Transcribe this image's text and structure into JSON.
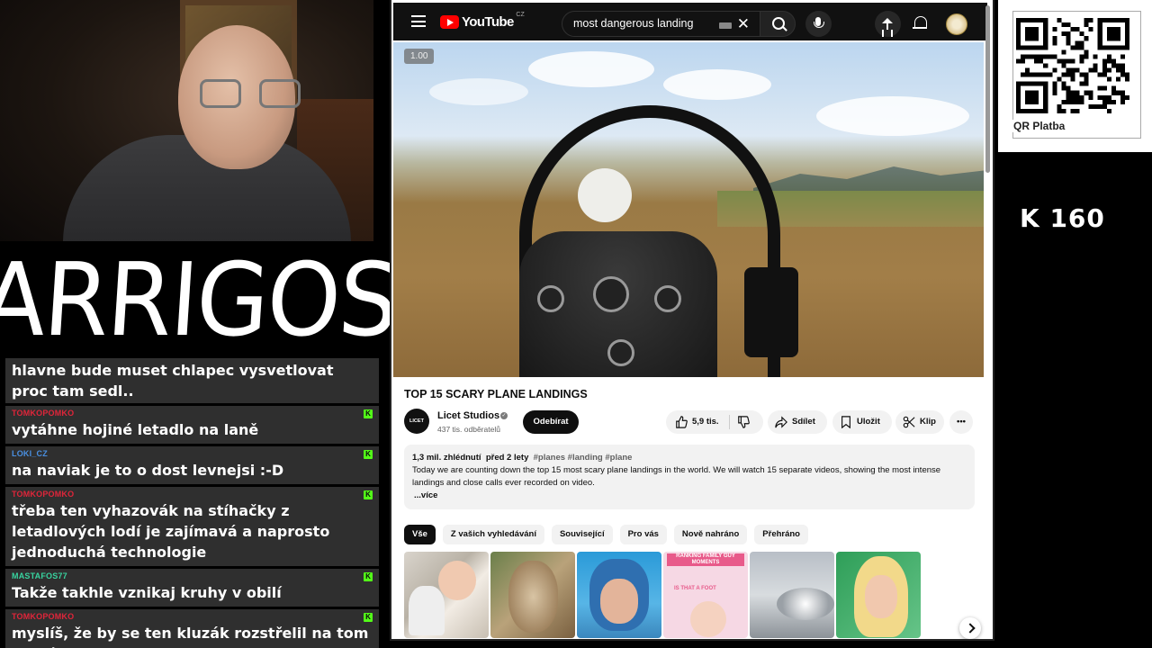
{
  "overlay": {
    "logo_text": "ARRIGOS",
    "counter": "K  160",
    "qr_label": "QR Platba"
  },
  "chat": {
    "partial_message": "hlavne bude muset chlapec vysvetlovat proc tam sedl..",
    "messages": [
      {
        "user": "TOMKOPOMKO",
        "user_color": "#e0253a",
        "text": "vytáhne hojiné letadlo na laně"
      },
      {
        "user": "LOKI_CZ",
        "user_color": "#4a90e2",
        "text": "na naviak je to o dost levnejsi :-D"
      },
      {
        "user": "TOMKOPOMKO",
        "user_color": "#e0253a",
        "text": "třeba ten vyhazovák na stíhačky z letadlových lodí je zajímavá a naprosto jednoduchá technologie"
      },
      {
        "user": "MASTAFOS77",
        "user_color": "#38d39f",
        "text": "Takže takhle vznikaj kruhy v obilí"
      },
      {
        "user": "TOMKOPOMKO",
        "user_color": "#e0253a",
        "text": "myslíš, že by se ten kluzák rozstřelil na tom parním koni? :D"
      }
    ],
    "platform_icon": "kick-icon",
    "platform_color": "#53fc18"
  },
  "youtube": {
    "brand": "YouTube",
    "country": "CZ",
    "search_value": "most dangerous landing",
    "speed": "1.00",
    "video_title": "TOP 15 SCARY PLANE LANDINGS",
    "channel": {
      "name": "Licet Studios",
      "avatar_text": "LICET STUDIOS",
      "subs": "437 tis. odběratelů"
    },
    "subscribe": "Odebírat",
    "likes": "5,9 tis.",
    "share": "Sdílet",
    "save": "Uložit",
    "clip": "Klip",
    "description": {
      "views": "1,3 mil. zhlédnutí",
      "date": "před 2 lety",
      "tags": "#planes #landing #plane",
      "text": "Today we are counting down the top 15 most scary plane landings in the world. We will watch 15 separate videos, showing the most intense landings and close calls ever recorded on video.",
      "more": "...více"
    },
    "chips": [
      "Vše",
      "Z vašich vyhledávání",
      "Související",
      "Pro vás",
      "Nově nahráno",
      "Přehráno"
    ],
    "thumbnails": [
      "thumb-baby-cat",
      "thumb-hawk",
      "thumb-pilot-face",
      "thumb-family-guy",
      "thumb-jet-engine",
      "thumb-woman"
    ],
    "thumb_texts": {
      "family_guy_top": "RANKING FAMILY GUY MOMENTS",
      "family_guy_bottom": "IS THAT A FOOT"
    }
  }
}
